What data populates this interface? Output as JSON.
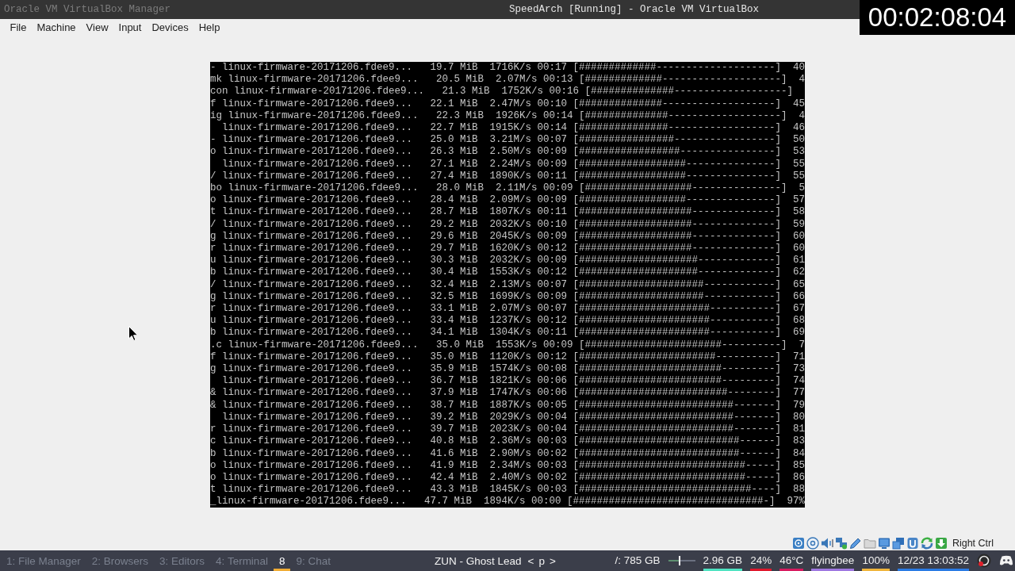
{
  "title_bar": {
    "inactive_title": "Oracle VM VirtualBox Manager",
    "title": "SpeedArch [Running] - Oracle VM VirtualBox"
  },
  "recording_timer": "00:02:08:04",
  "menu": [
    "File",
    "Machine",
    "View",
    "Input",
    "Devices",
    "Help"
  ],
  "vm_screen": {
    "lines": [
      "- linux-firmware-20171206.fdee9...   19.7 MiB  1716K/s 00:17 [#############--------------------]  40",
      "mk linux-firmware-20171206.fdee9...   20.5 MiB  2.07M/s 00:13 [#############--------------------]  4",
      "con linux-firmware-20171206.fdee9...   21.3 MiB  1752K/s 00:16 [##############-------------------]",
      "f linux-firmware-20171206.fdee9...   22.1 MiB  2.47M/s 00:10 [##############-------------------]  45",
      "ig linux-firmware-20171206.fdee9...   22.3 MiB  1926K/s 00:14 [##############-------------------]  4",
      "  linux-firmware-20171206.fdee9...   22.7 MiB  1915K/s 00:14 [###############------------------]  46",
      "- linux-firmware-20171206.fdee9...   25.0 MiB  3.21M/s 00:07 [################-----------------]  50",
      "o linux-firmware-20171206.fdee9...   26.3 MiB  2.50M/s 00:09 [#################----------------]  53",
      "  linux-firmware-20171206.fdee9...   27.1 MiB  2.24M/s 00:09 [##################---------------]  55",
      "/ linux-firmware-20171206.fdee9...   27.4 MiB  1890K/s 00:11 [##################---------------]  55",
      "bo linux-firmware-20171206.fdee9...   28.0 MiB  2.11M/s 00:09 [##################---------------]  5",
      "o linux-firmware-20171206.fdee9...   28.4 MiB  2.09M/s 00:09 [##################---------------]  57",
      "t linux-firmware-20171206.fdee9...   28.7 MiB  1807K/s 00:11 [###################--------------]  58",
      "/ linux-firmware-20171206.fdee9...   29.2 MiB  2032K/s 00:10 [###################--------------]  59",
      "g linux-firmware-20171206.fdee9...   29.6 MiB  2045K/s 00:09 [###################--------------]  60",
      "r linux-firmware-20171206.fdee9...   29.7 MiB  1620K/s 00:12 [###################--------------]  60",
      "u linux-firmware-20171206.fdee9...   30.3 MiB  2032K/s 00:09 [####################-------------]  61",
      "b linux-firmware-20171206.fdee9...   30.4 MiB  1553K/s 00:12 [####################-------------]  62",
      "/ linux-firmware-20171206.fdee9...   32.4 MiB  2.13M/s 00:07 [#####################------------]  65",
      "g linux-firmware-20171206.fdee9...   32.5 MiB  1699K/s 00:09 [#####################------------]  66",
      "r linux-firmware-20171206.fdee9...   33.1 MiB  2.07M/s 00:07 [######################-----------]  67",
      "u linux-firmware-20171206.fdee9...   33.4 MiB  1237K/s 00:12 [######################-----------]  68",
      "b linux-firmware-20171206.fdee9...   34.1 MiB  1304K/s 00:11 [######################-----------]  69",
      ".c linux-firmware-20171206.fdee9...   35.0 MiB  1553K/s 00:09 [#######################----------]  7",
      "f linux-firmware-20171206.fdee9...   35.0 MiB  1120K/s 00:12 [#######################----------]  71",
      "g linux-firmware-20171206.fdee9...   35.9 MiB  1574K/s 00:08 [########################---------]  73",
      "  linux-firmware-20171206.fdee9...   36.7 MiB  1821K/s 00:06 [########################---------]  74",
      "& linux-firmware-20171206.fdee9...   37.9 MiB  1747K/s 00:06 [#########################--------]  77",
      "& linux-firmware-20171206.fdee9...   38.7 MiB  1887K/s 00:05 [##########################-------]  79",
      "  linux-firmware-20171206.fdee9...   39.2 MiB  2029K/s 00:04 [##########################-------]  80",
      "r linux-firmware-20171206.fdee9...   39.7 MiB  2023K/s 00:04 [##########################-------]  81",
      "c linux-firmware-20171206.fdee9...   40.8 MiB  2.36M/s 00:03 [###########################------]  83",
      "b linux-firmware-20171206.fdee9...   41.6 MiB  2.90M/s 00:02 [###########################------]  84",
      "o linux-firmware-20171206.fdee9...   41.9 MiB  2.34M/s 00:03 [############################-----]  85",
      "o linux-firmware-20171206.fdee9...   42.4 MiB  2.40M/s 00:02 [############################-----]  86",
      "t linux-firmware-20171206.fdee9...   43.3 MiB  1845K/s 00:03 [#############################----]  88",
      "_linux-firmware-20171206.fdee9...   47.7 MiB  1894K/s 00:00 [################################-]  97%"
    ]
  },
  "vm_status_bar": {
    "host_key": "Right Ctrl"
  },
  "taskbar": {
    "workspaces": [
      {
        "label": "1: File Manager",
        "selected": false
      },
      {
        "label": "2: Browsers",
        "selected": false
      },
      {
        "label": "3: Editors",
        "selected": false
      },
      {
        "label": "4: Terminal",
        "selected": false
      },
      {
        "label": "8",
        "selected": true
      },
      {
        "label": "9: Chat",
        "selected": false
      }
    ],
    "now_playing": "ZUN - Ghost Lead",
    "media_controls": [
      "<",
      "p",
      ">"
    ],
    "modules": [
      {
        "kind": "text",
        "text": "/: 785 GB"
      },
      {
        "kind": "bar",
        "level": 0.45
      },
      {
        "kind": "text",
        "text": "2.96 GB",
        "color": "#4fe3c1"
      },
      {
        "kind": "text",
        "text": "24%",
        "color": "#e0182d"
      },
      {
        "kind": "text",
        "text": "46°C",
        "color": "#d81b60"
      },
      {
        "kind": "text",
        "text": "flyingbee",
        "color": "#9f78e1"
      },
      {
        "kind": "text",
        "text": "100%",
        "color": "#f0b53c"
      },
      {
        "kind": "text",
        "text": "12/23 13:03:52",
        "color": "#2a7be4"
      }
    ]
  }
}
